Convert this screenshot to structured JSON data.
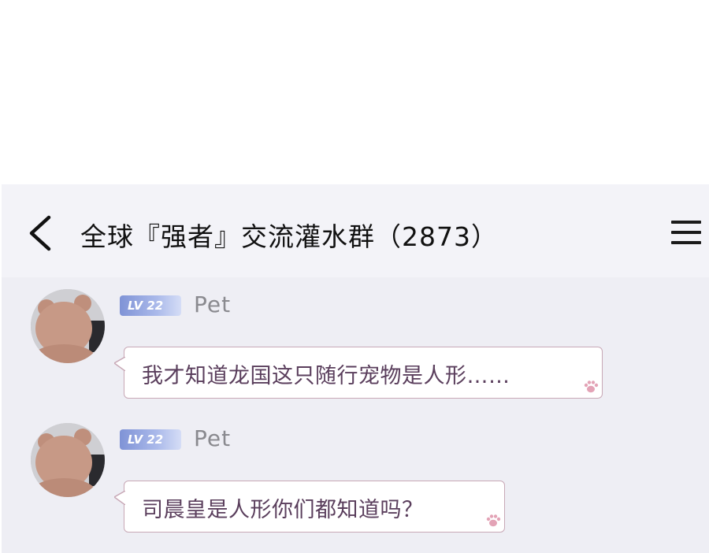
{
  "header": {
    "back_icon": "chevron-left-icon",
    "title": "全球『强者』交流灌水群（2873）",
    "menu_icon": "hamburger-menu-icon"
  },
  "messages": [
    {
      "avatar": "bear-avatar",
      "level": "LV 22",
      "sender": "Pet",
      "text": "我才知道龙国这只随行宠物是人形……",
      "decoration_icon": "paw-icon"
    },
    {
      "avatar": "bear-avatar",
      "level": "LV 22",
      "sender": "Pet",
      "text": "司晨皇是人形你们都知道吗？",
      "decoration_icon": "paw-icon"
    }
  ],
  "colors": {
    "chat_background": "#eeeef4",
    "header_background": "#f3f3f8",
    "bubble_border": "#c8a8b6",
    "bubble_text": "#5a3e5c",
    "level_badge": "#8fa0dc",
    "paw": "#e3a3b6"
  }
}
